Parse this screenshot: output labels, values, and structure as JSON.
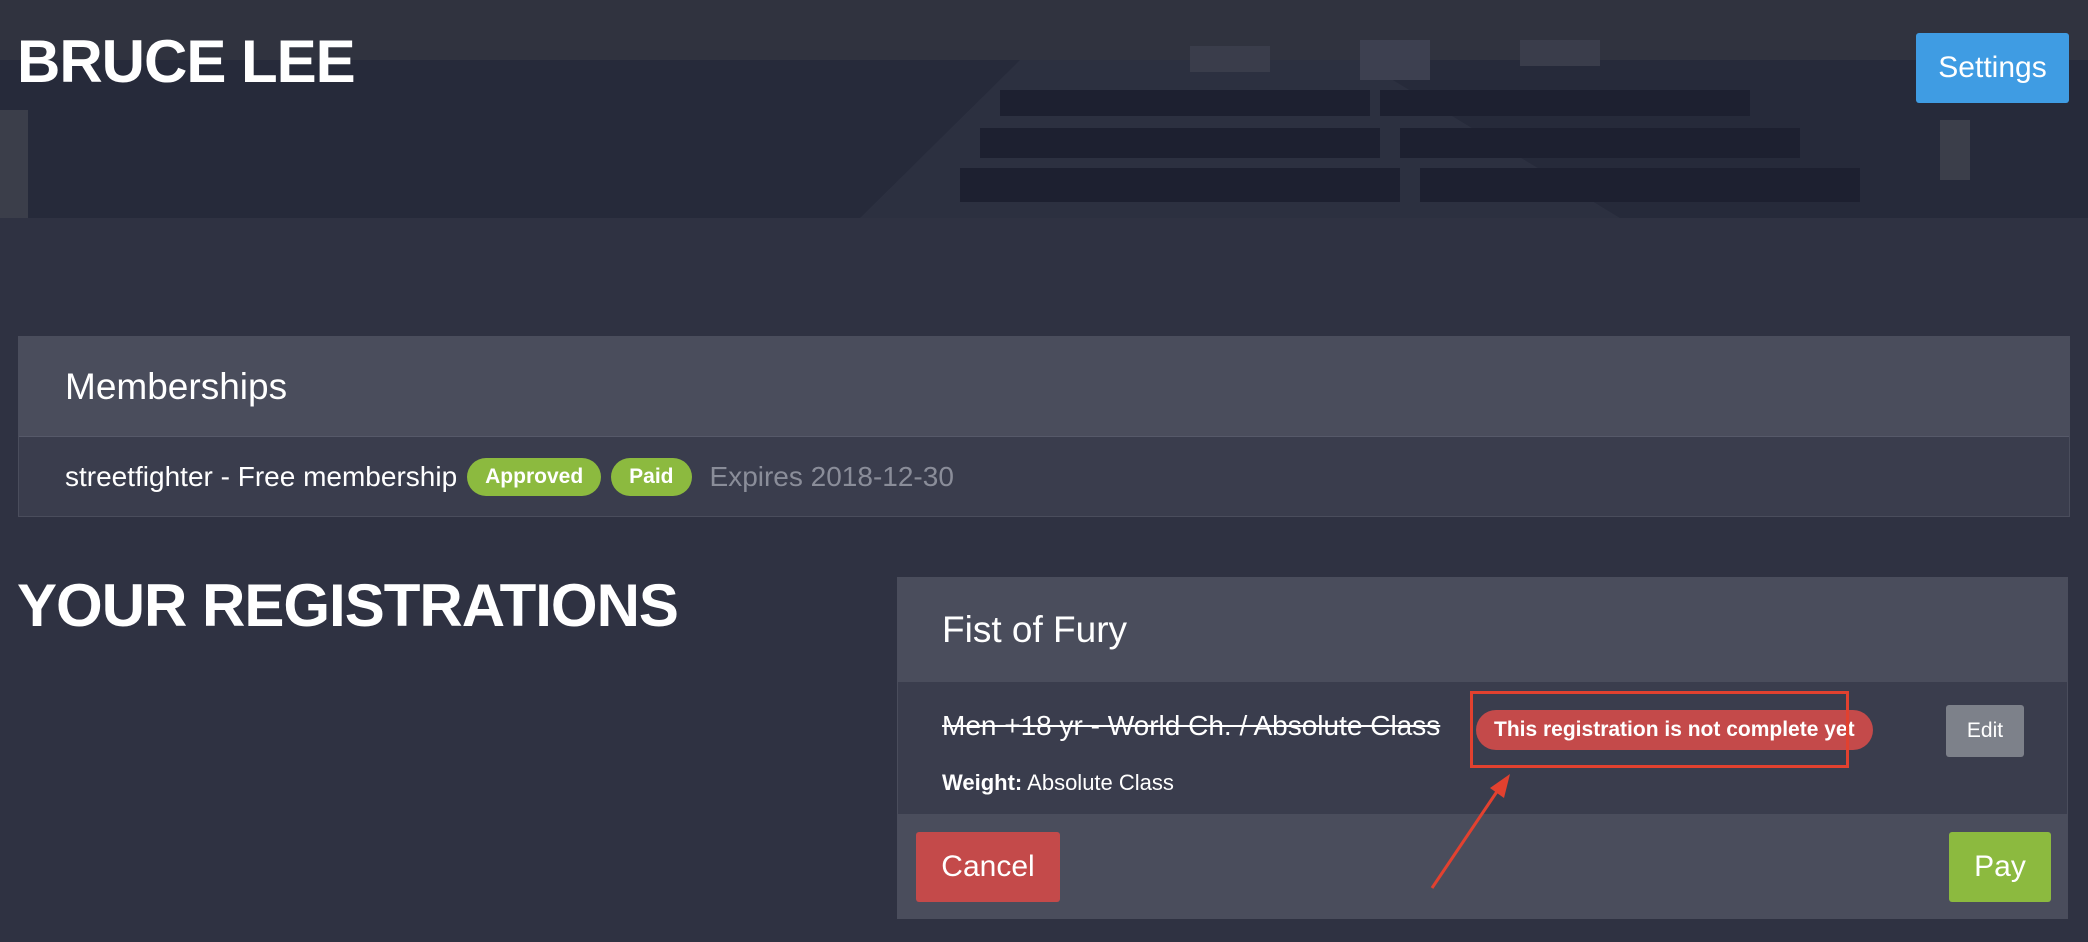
{
  "hero": {
    "title": "BRUCE LEE",
    "settings_label": "Settings"
  },
  "memberships": {
    "heading": "Memberships",
    "items": [
      {
        "name": "streetfighter - Free membership",
        "badges": [
          "Approved",
          "Paid"
        ],
        "expires": "Expires 2018-12-30"
      }
    ]
  },
  "registrations": {
    "heading": "YOUR REGISTRATIONS",
    "cards": [
      {
        "event": "Fist of Fury",
        "class": "Men +18 yr - World Ch. / Absolute Class",
        "warning": "This registration is not complete yet",
        "edit_label": "Edit",
        "weight_label": "Weight:",
        "weight_value": "Absolute Class",
        "cancel_label": "Cancel",
        "pay_label": "Pay"
      }
    ]
  },
  "colors": {
    "background": "#2f3242",
    "panel": "#3a3d4d",
    "panel_header": "#4a4d5c",
    "accent_blue": "#3f9ce3",
    "success_green": "#8cba3f",
    "danger_red": "#c44a4a",
    "annotation_red": "#e2412f",
    "muted_gray": "#7d818a"
  }
}
